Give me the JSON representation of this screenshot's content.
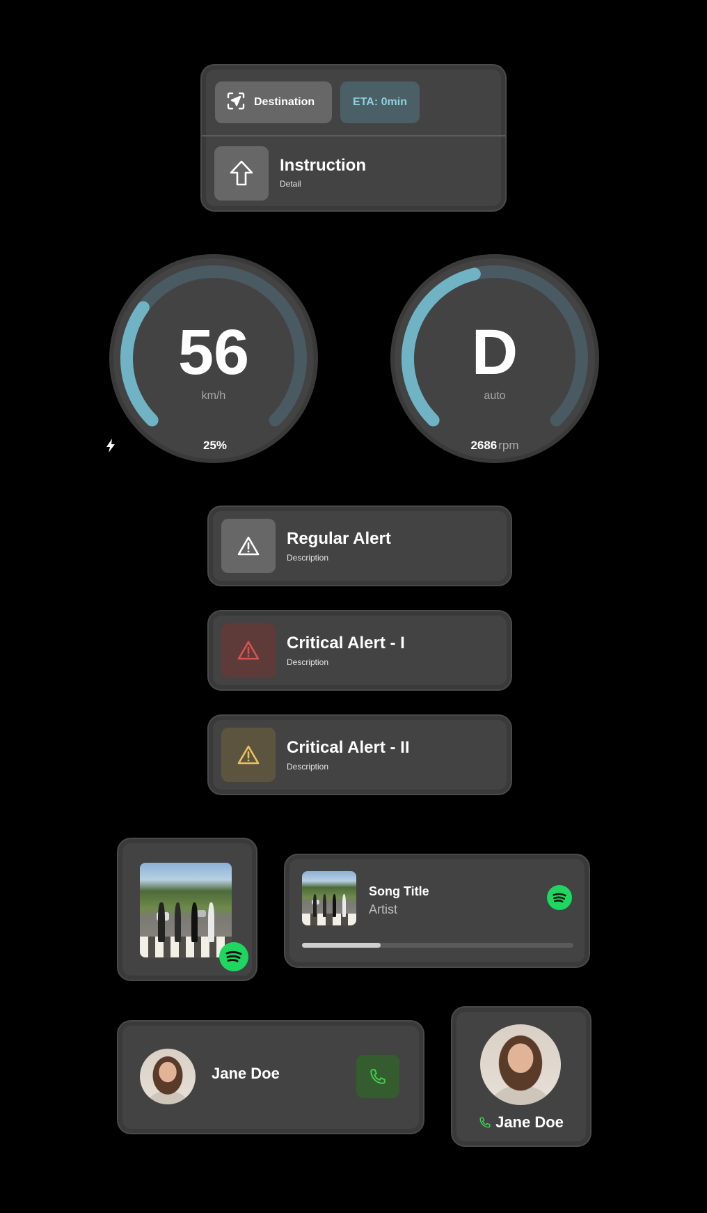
{
  "navigation": {
    "destination_label": "Destination",
    "eta_label": "ETA: 0min",
    "instruction_title": "Instruction",
    "instruction_detail": "Detail"
  },
  "speed_gauge": {
    "value": "56",
    "unit": "km/h",
    "battery": "25%",
    "level": 0.3
  },
  "gear_gauge": {
    "value": "D",
    "mode": "auto",
    "rpm_value": "2686",
    "rpm_unit": "rpm",
    "level": 0.45
  },
  "alerts": [
    {
      "title": "Regular Alert",
      "description": "Description",
      "severity": "regular",
      "icon": "warning-triangle-icon",
      "icon_color": "#ffffff",
      "bg": "#676767"
    },
    {
      "title": "Critical Alert - I",
      "description": "Description",
      "severity": "critical-1",
      "icon": "warning-triangle-icon",
      "icon_color": "#d9534f",
      "bg": "#5e3a39"
    },
    {
      "title": "Critical Alert - II",
      "description": "Description",
      "severity": "critical-2",
      "icon": "warning-triangle-icon",
      "icon_color": "#e8c25a",
      "bg": "#5d5440"
    }
  ],
  "player": {
    "song_title": "Song Title",
    "artist": "Artist",
    "progress": 0.29,
    "service_icon": "spotify-icon"
  },
  "contact": {
    "name": "Jane Doe",
    "call_icon": "phone-icon"
  },
  "colors": {
    "accent_arc": "#6fb3c5",
    "track_arc": "#4a5a62",
    "spotify_green": "#1ed760",
    "call_green": "#3ccf4e"
  }
}
